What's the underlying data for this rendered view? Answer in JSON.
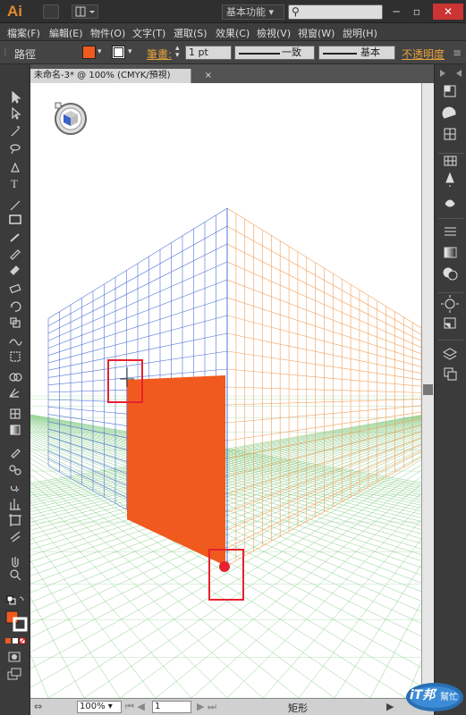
{
  "app": {
    "logo": "Ai",
    "workspace": "基本功能"
  },
  "window_controls": {
    "minimize": "─",
    "restore": "▫",
    "close": "✕"
  },
  "menus": [
    "檔案(F)",
    "編輯(E)",
    "物件(O)",
    "文字(T)",
    "選取(S)",
    "效果(C)",
    "檢視(V)",
    "視窗(W)",
    "說明(H)"
  ],
  "control_bar": {
    "object_type": "路徑",
    "stroke_label": "筆畫:",
    "stroke_weight": "1 pt",
    "profile": "一致",
    "brush": "基本",
    "opacity_label": "不透明度",
    "fill_color": "#f05a1e",
    "stroke_color": "#ffffff"
  },
  "document": {
    "tab_title": "未命名-3* @ 100% (CMYK/預視)",
    "tab_close": "×"
  },
  "status": {
    "zoom": "100%",
    "artboard": "1",
    "tool": "矩形"
  },
  "colors": {
    "orange": "#f05a1e",
    "blue_grid": "#4f73d6",
    "orange_grid": "#f2a15c",
    "green_grid": "#8ccf8c",
    "highlight": "#e8212e"
  },
  "watermark": {
    "brand": "iT邦",
    "sub": "幫忙"
  },
  "icons": {
    "tools": [
      "selection-arrow-icon",
      "direct-selection-icon",
      "magic-wand-icon",
      "lasso-icon",
      "pen-icon",
      "type-icon",
      "line-segment-icon",
      "rectangle-icon",
      "paintbrush-icon",
      "pencil-icon",
      "blob-brush-icon",
      "eraser-icon",
      "rotate-icon",
      "scale-icon",
      "warp-icon",
      "free-transform-icon",
      "shape-builder-icon",
      "perspective-grid-icon",
      "mesh-icon",
      "gradient-icon",
      "eyedropper-icon",
      "blend-icon",
      "symbol-sprayer-icon",
      "column-graph-icon",
      "artboard-icon",
      "slice-icon",
      "hand-icon",
      "zoom-icon"
    ],
    "right_panel": [
      "color-guide-icon",
      "color-icon",
      "swatches-icon",
      "brushes-icon",
      "symbols-icon",
      "stroke-icon",
      "gradient-icon",
      "transparency-icon",
      "appearance-icon",
      "graphic-styles-icon",
      "layers-icon",
      "artboards-icon"
    ]
  }
}
